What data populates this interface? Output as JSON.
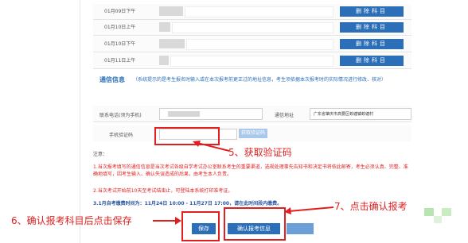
{
  "exam_rows": [
    {
      "time": "01月09日下午",
      "blur_width": 30,
      "delete_label": "删除科目"
    },
    {
      "time": "01月10日上午",
      "blur_width": 14,
      "delete_label": "删除科目"
    },
    {
      "time": "01月10日下午",
      "blur_width": 32,
      "delete_label": "删除科目"
    },
    {
      "time": "01月11日上午",
      "blur_width": 12,
      "delete_label": "删除科目"
    }
  ],
  "contact": {
    "title": "通信信息",
    "note": "（系统提示的是考生报名时输入或在本次报考前更正过的地址信息，考生须依据本次报考时的实际情况进行修改、核对）",
    "phone_label": "联系电话(须为手机)",
    "address_label": "通信地址",
    "address_value": "广东省肇庆市高要区蛟塘镇蛟塘村",
    "code_label": "手机验证码",
    "get_code_button": "获取验证码"
  },
  "notice": {
    "title": "注意：",
    "lines": [
      "1.当次报考填写的通信信息是当次考试各级自学考试办公室联系考生的重要渠道，选规处理事先告知书和决定书将依此邮寄，考生必须认真、完整、准确地填写，因考生输入、确认失误造成的后果，由考生本人负责。",
      "2.当次考试开始前10天至考试结束止，可登陆本系统打印准考证。",
      "3.1月自考缴费时间为：11月24日 10:00 - 11月27日 17:00，请在此时间段内缴费。"
    ]
  },
  "buttons": {
    "save": "保存",
    "confirm": "确认报考信息"
  },
  "callouts": {
    "step5": "5、获取验证码",
    "step6": "6、确认报考科目后点击保存",
    "step7": "7、点击确认报考"
  },
  "colors": {
    "accent": "#2a6fb8",
    "annotation": "#e02020"
  }
}
